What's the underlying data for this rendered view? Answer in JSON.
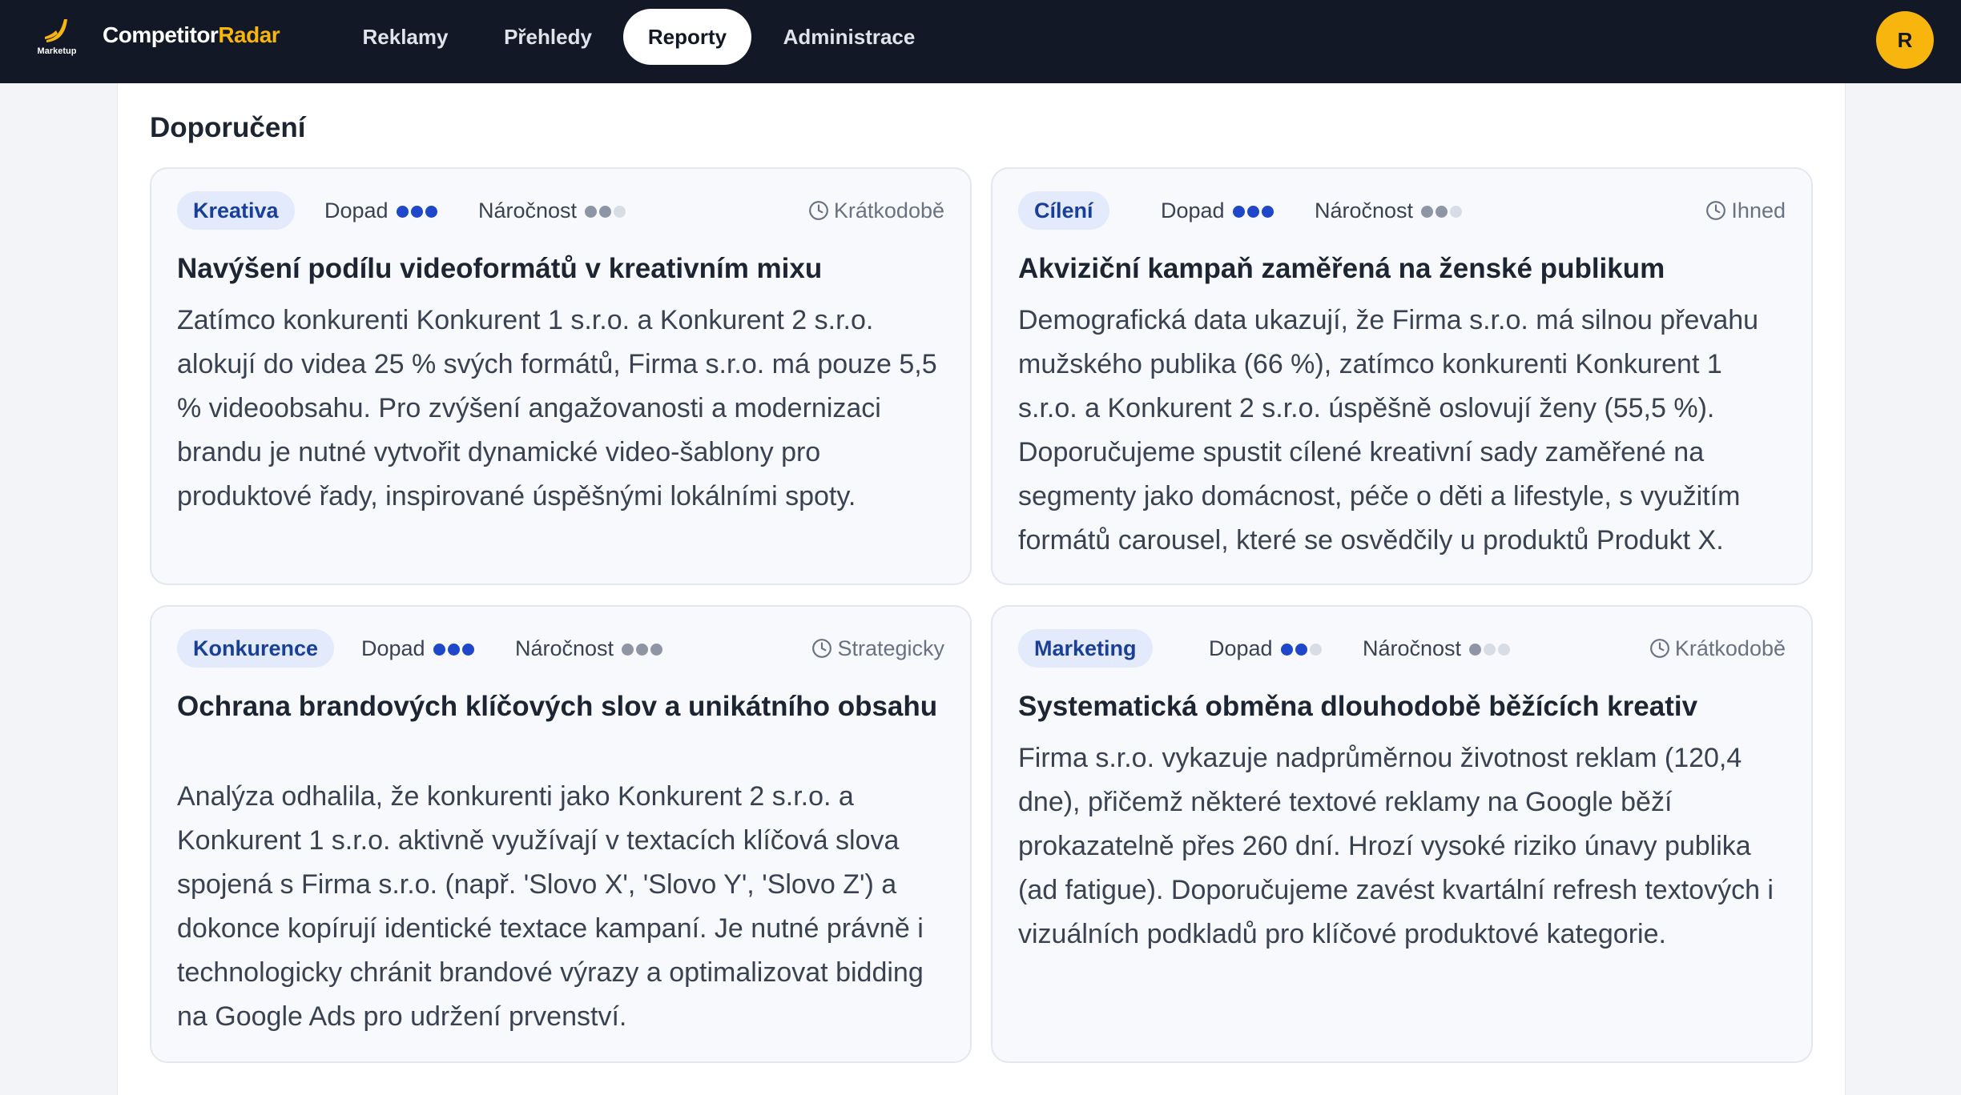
{
  "app": {
    "logo_text": "Marketup",
    "brand_main": "Competitor",
    "brand_accent": "Radar",
    "avatar_initial": "R"
  },
  "nav": [
    {
      "label": "Reklamy",
      "active": false
    },
    {
      "label": "Přehledy",
      "active": false
    },
    {
      "label": "Reporty",
      "active": true
    },
    {
      "label": "Administrace",
      "active": false
    }
  ],
  "section": {
    "title": "Doporučení"
  },
  "colors": {
    "nav_bg": "#121826",
    "accent": "#f7b50e",
    "tag_bg": "#e2eafb",
    "tag_text": "#1a3f99",
    "impact_dot": "#1e47c9",
    "effort_dot": "#8e96a5"
  },
  "cards": [
    {
      "tag": "Kreativa",
      "impact_label": "Dopad",
      "impact_level": 3,
      "impact_max": 3,
      "effort_label": "Náročnost",
      "effort_level": 2,
      "effort_max": 3,
      "timing_icon": "clock-icon",
      "timing": "Krátkodobě",
      "title": "Navýšení podílu videoformátů v kreativním mixu",
      "body": "Zatímco konkurenti Konkurent 1 s.r.o. a Konkurent 2 s.r.o. alokují do videa 25 % svých formátů, Firma s.r.o. má pouze 5,5 % videoobsahu. Pro zvýšení angažovanosti a modernizaci brandu je nutné vytvořit dynamické video-šablony pro produktové řady, inspirované úspěšnými lokálními spoty."
    },
    {
      "tag": "Cílení",
      "impact_label": "Dopad",
      "impact_level": 3,
      "impact_max": 3,
      "effort_label": "Náročnost",
      "effort_level": 2,
      "effort_max": 3,
      "timing_icon": "clock-icon",
      "timing": "Ihned",
      "title": "Akviziční kampaň zaměřená na ženské publikum",
      "body": "Demografická data ukazují, že Firma s.r.o. má silnou převahu mužského publika (66 %), zatímco konkurenti Konkurent 1 s.r.o. a Konkurent 2 s.r.o. úspěšně oslovují ženy (55,5 %). Doporučujeme spustit cílené kreativní sady zaměřené na segmenty jako domácnost, péče o děti a lifestyle, s využitím formátů carousel, které se osvědčily u produktů Produkt X."
    },
    {
      "tag": "Konkurence",
      "impact_label": "Dopad",
      "impact_level": 3,
      "impact_max": 3,
      "effort_label": "Náročnost",
      "effort_level": 3,
      "effort_max": 3,
      "timing_icon": "clock-icon",
      "timing": "Strategicky",
      "title": "Ochrana brandových klíčových slov a unikátního obsahu",
      "body": "Analýza odhalila, že konkurenti jako Konkurent 2 s.r.o. a Konkurent 1 s.r.o. aktivně využívají v textacích klíčová slova spojená s Firma s.r.o. (např. 'Slovo X', 'Slovo Y', 'Slovo Z') a dokonce kopírují identické textace kampaní. Je nutné právně i technologicky chránit brandové výrazy a optimalizovat bidding na Google Ads pro udržení prvenství."
    },
    {
      "tag": "Marketing",
      "impact_label": "Dopad",
      "impact_level": 2,
      "impact_max": 3,
      "effort_label": "Náročnost",
      "effort_level": 1,
      "effort_max": 3,
      "timing_icon": "clock-icon",
      "timing": "Krátkodobě",
      "title": "Systematická obměna dlouhodobě běžících kreativ",
      "body": "Firma s.r.o. vykazuje nadprůměrnou životnost reklam (120,4 dne), přičemž některé textové reklamy na Google běží prokazatelně přes 260 dní. Hrozí vysoké riziko únavy publika (ad fatigue). Doporučujeme zavést kvartální refresh textových i vizuálních podkladů pro klíčové produktové kategorie."
    }
  ]
}
